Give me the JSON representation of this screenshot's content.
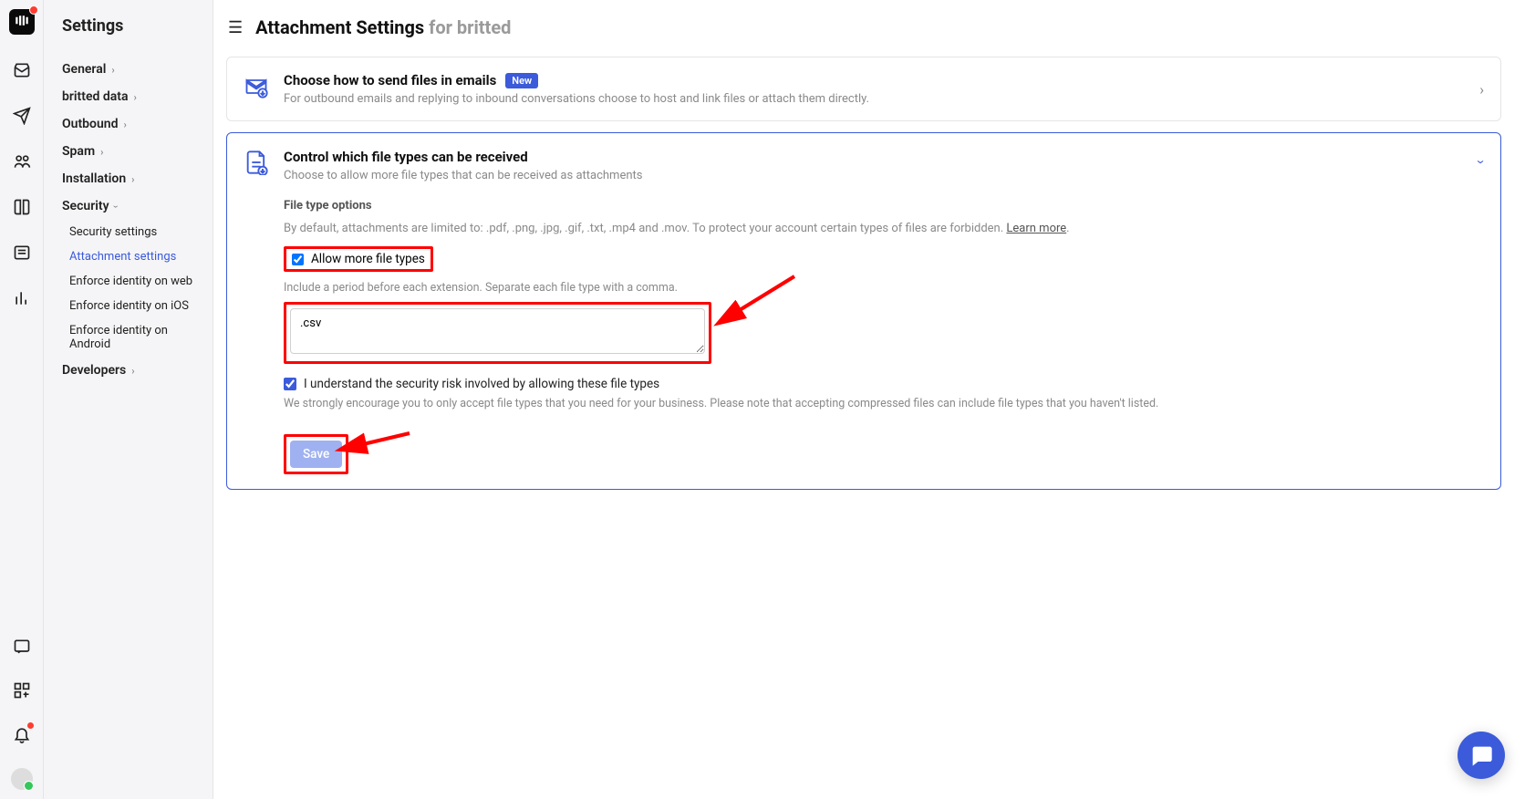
{
  "sidebar": {
    "title": "Settings",
    "items": [
      {
        "label": "General"
      },
      {
        "label": "britted data"
      },
      {
        "label": "Outbound"
      },
      {
        "label": "Spam"
      },
      {
        "label": "Installation"
      },
      {
        "label": "Security",
        "expanded": true,
        "children": [
          {
            "label": "Security settings"
          },
          {
            "label": "Attachment settings",
            "active": true
          },
          {
            "label": "Enforce identity on web"
          },
          {
            "label": "Enforce identity on iOS"
          },
          {
            "label": "Enforce identity on Android"
          }
        ]
      },
      {
        "label": "Developers"
      }
    ]
  },
  "page": {
    "title_main": "Attachment Settings ",
    "title_sub": "for britted"
  },
  "card1": {
    "title": "Choose how to send files in emails",
    "badge": "New",
    "desc": "For outbound emails and replying to inbound conversations choose to host and link files or attach them directly."
  },
  "card2": {
    "title": "Control which file types can be received",
    "desc": "Choose to allow more file types that can be received as attachments",
    "section_label": "File type options",
    "default_text": "By default, attachments are limited to: .pdf, .png, .jpg, .gif, .txt, .mp4 and .mov. To protect your account certain types of files are forbidden. ",
    "learn_more": "Learn more",
    "allow_label": "Allow more file types",
    "include_help": "Include a period before each extension. Separate each file type with a comma.",
    "input_value": ".csv",
    "understand_label": "I understand the security risk involved by allowing these file types",
    "understand_help": "We strongly encourage you to only accept file types that you need for your business. Please note that accepting compressed files can include file types that you haven't listed.",
    "save_label": "Save"
  }
}
